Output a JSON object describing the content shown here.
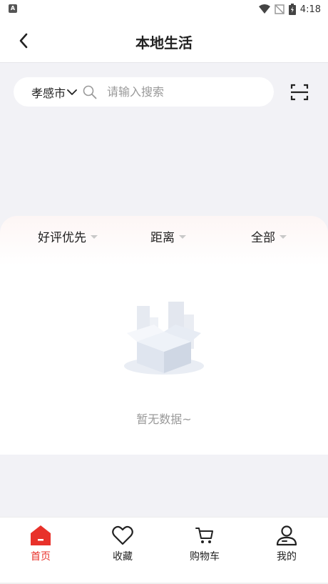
{
  "status_bar": {
    "time": "4:18",
    "app_icon": "A"
  },
  "header": {
    "title": "本地生活",
    "back_icon": "chevron-left-icon"
  },
  "search": {
    "city": "孝感市",
    "placeholder": "请输入搜索",
    "scan_icon": "scan-icon"
  },
  "filters": [
    {
      "label": "好评优先"
    },
    {
      "label": "距离"
    },
    {
      "label": "全部"
    }
  ],
  "empty_state": {
    "message": "暂无数据~"
  },
  "tabs": [
    {
      "label": "首页",
      "icon": "home-icon",
      "active": true
    },
    {
      "label": "收藏",
      "icon": "heart-icon",
      "active": false
    },
    {
      "label": "购物车",
      "icon": "cart-icon",
      "active": false
    },
    {
      "label": "我的",
      "icon": "user-icon",
      "active": false
    }
  ],
  "colors": {
    "accent": "#e8312a",
    "background": "#f2f2f6"
  }
}
